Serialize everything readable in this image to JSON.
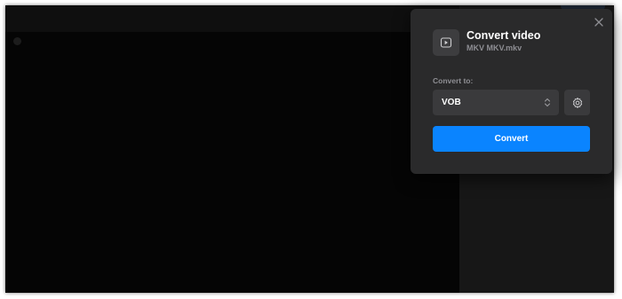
{
  "dialog": {
    "title": "Convert video",
    "filename": "MKV MKV.mkv",
    "convert_to_label": "Convert to:",
    "format_select": {
      "selected": "VOB"
    },
    "convert_button_label": "Convert"
  },
  "icons": {
    "close": "close-icon",
    "file": "video-play-icon",
    "select_arrow": "chevron-up-down-icon",
    "settings": "gear-icon"
  },
  "colors": {
    "dialog_background": "#2a2a2b",
    "control_background": "#3a3a3c",
    "accent": "#0a84ff",
    "secondary_text": "#8e8e93",
    "video_background": "#050505"
  }
}
